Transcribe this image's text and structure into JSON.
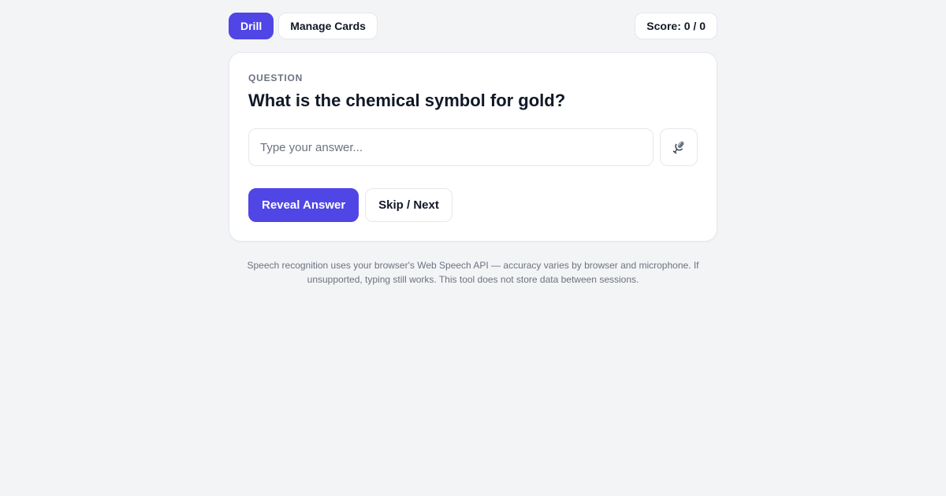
{
  "nav": {
    "tabs": [
      {
        "label": "Drill",
        "active": true
      },
      {
        "label": "Manage Cards",
        "active": false
      }
    ],
    "score": "Score: 0 / 0"
  },
  "card": {
    "label": "QUESTION",
    "question": "What is the chemical symbol for gold?",
    "answer_value": "",
    "answer_placeholder": "Type your answer...",
    "mic_icon": "microphone-icon",
    "reveal_label": "Reveal Answer",
    "skip_label": "Skip / Next"
  },
  "footnote": "Speech recognition uses your browser's Web Speech API — accuracy varies by browser and microphone. If unsupported, typing still works. This tool does not store data between sessions.",
  "colors": {
    "accent": "#4f46e5",
    "background": "#f3f4f6",
    "card": "#ffffff",
    "border": "#e5e7eb",
    "muted_text": "#6b7280",
    "text": "#111827"
  }
}
